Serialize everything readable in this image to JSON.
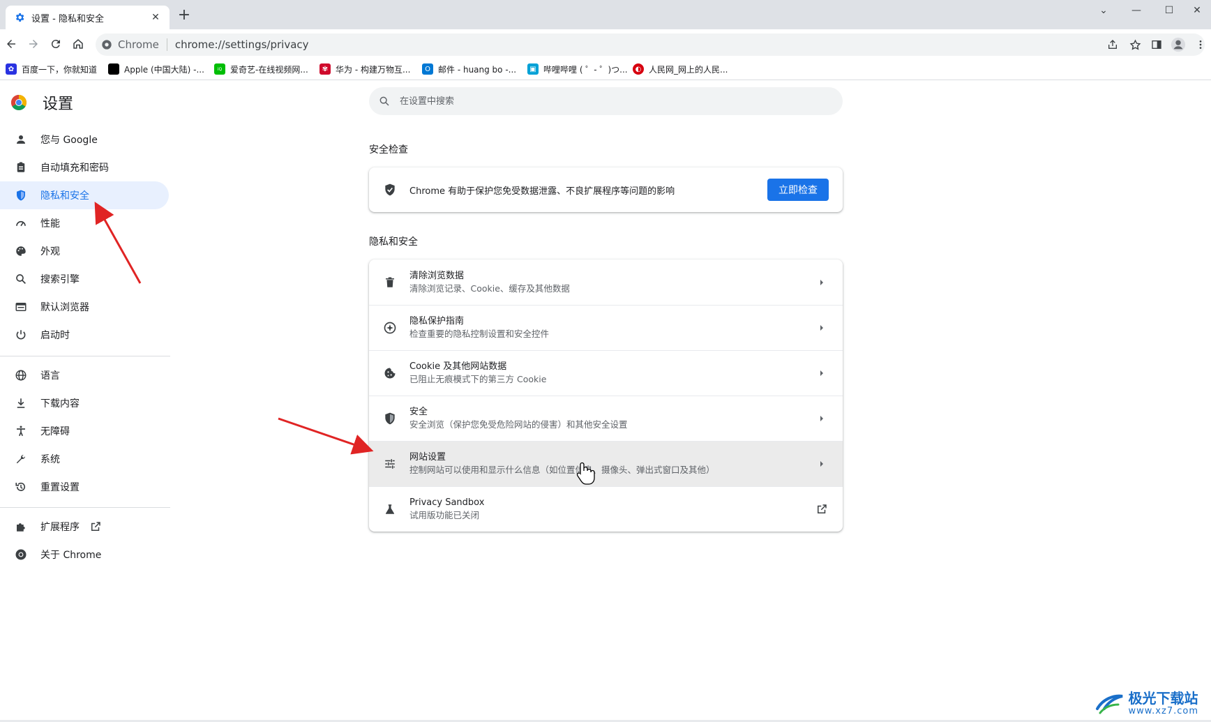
{
  "window": {
    "tab_title": "设置 - 隐私和安全",
    "new_tab": "+",
    "close_tab": "✕"
  },
  "toolbar": {
    "site_name": "Chrome",
    "url": "chrome://settings/privacy"
  },
  "bookmarks": [
    {
      "label": "百度一下，你就知道",
      "icon": "baidu-icon",
      "color": "#2932e1"
    },
    {
      "label": "Apple (中国大陆) -...",
      "icon": "apple-icon",
      "color": "#000000"
    },
    {
      "label": "爱奇艺-在线视频网...",
      "icon": "iqiyi-icon",
      "color": "#00be06"
    },
    {
      "label": "华为 - 构建万物互...",
      "icon": "huawei-icon",
      "color": "#cf0a2c"
    },
    {
      "label": "邮件 - huang bo -...",
      "icon": "outlook-icon",
      "color": "#0078d4"
    },
    {
      "label": "哔哩哔哩 ( ゜- ゜)つ...",
      "icon": "bilibili-icon",
      "color": "#00a1d6"
    },
    {
      "label": "人民网_网上的人民...",
      "icon": "people-icon",
      "color": "#d7000f"
    }
  ],
  "settings": {
    "title": "设置",
    "search_placeholder": "在设置中搜索",
    "nav": [
      {
        "label": "您与 Google",
        "icon": "person-icon"
      },
      {
        "label": "自动填充和密码",
        "icon": "clipboard-icon"
      },
      {
        "label": "隐私和安全",
        "icon": "shield-icon",
        "active": true
      },
      {
        "label": "性能",
        "icon": "speedometer-icon"
      },
      {
        "label": "外观",
        "icon": "palette-icon"
      },
      {
        "label": "搜索引擎",
        "icon": "search-icon"
      },
      {
        "label": "默认浏览器",
        "icon": "browser-icon"
      },
      {
        "label": "启动时",
        "icon": "power-icon"
      },
      {
        "label": "语言",
        "icon": "globe-icon"
      },
      {
        "label": "下载内容",
        "icon": "download-icon"
      },
      {
        "label": "无障碍",
        "icon": "accessibility-icon"
      },
      {
        "label": "系统",
        "icon": "wrench-icon"
      },
      {
        "label": "重置设置",
        "icon": "history-icon"
      },
      {
        "label": "扩展程序",
        "icon": "puzzle-icon"
      },
      {
        "label": "关于 Chrome",
        "icon": "chrome-icon"
      }
    ],
    "safety_check": {
      "heading": "安全检查",
      "text": "Chrome 有助于保护您免受数据泄露、不良扩展程序等问题的影响",
      "button": "立即检查"
    },
    "privacy": {
      "heading": "隐私和安全",
      "rows": [
        {
          "title": "清除浏览数据",
          "subtitle": "清除浏览记录、Cookie、缓存及其他数据",
          "icon": "trash-icon"
        },
        {
          "title": "隐私保护指南",
          "subtitle": "检查重要的隐私控制设置和安全控件",
          "icon": "compass-icon"
        },
        {
          "title": "Cookie 及其他网站数据",
          "subtitle": "已阻止无痕模式下的第三方 Cookie",
          "icon": "cookie-icon"
        },
        {
          "title": "安全",
          "subtitle": "安全浏览（保护您免受危险网站的侵害）和其他安全设置",
          "icon": "shield-icon"
        },
        {
          "title": "网站设置",
          "subtitle": "控制网站可以使用和显示什么信息（如位置信息、摄像头、弹出式窗口及其他）",
          "icon": "tune-icon"
        },
        {
          "title": "Privacy Sandbox",
          "subtitle": "试用版功能已关闭",
          "icon": "flask-icon"
        }
      ]
    }
  },
  "watermark": {
    "name": "极光下载站",
    "url": "www.xz7.com"
  },
  "colors": {
    "accent": "#1a73e8",
    "active_nav_bg": "#e8f0fe",
    "annotation_arrow": "#e02424"
  }
}
